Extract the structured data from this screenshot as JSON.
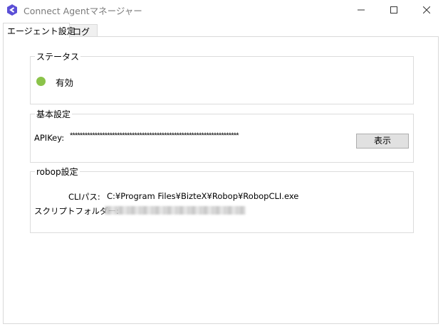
{
  "window": {
    "title": "Connect Agentマネージャー",
    "icon": "connect-agent-logo"
  },
  "tabs": [
    {
      "label": "エージェント設定",
      "selected": true
    },
    {
      "label": "ログ",
      "selected": false
    }
  ],
  "status_group": {
    "title": "ステータス",
    "status_text": "有効",
    "status_color": "#8bc34a"
  },
  "basic_group": {
    "title": "基本設定",
    "apikey_label": "APIKey:",
    "apikey_value": "********************************************************************",
    "show_button": "表示"
  },
  "robop_group": {
    "title": "robop設定",
    "cli_label": "CLIパス:",
    "cli_value": "C:¥Program Files¥BizteX¥Robop¥RobopCLI.exe",
    "script_folder_label": "スクリプトフォルダー:"
  }
}
